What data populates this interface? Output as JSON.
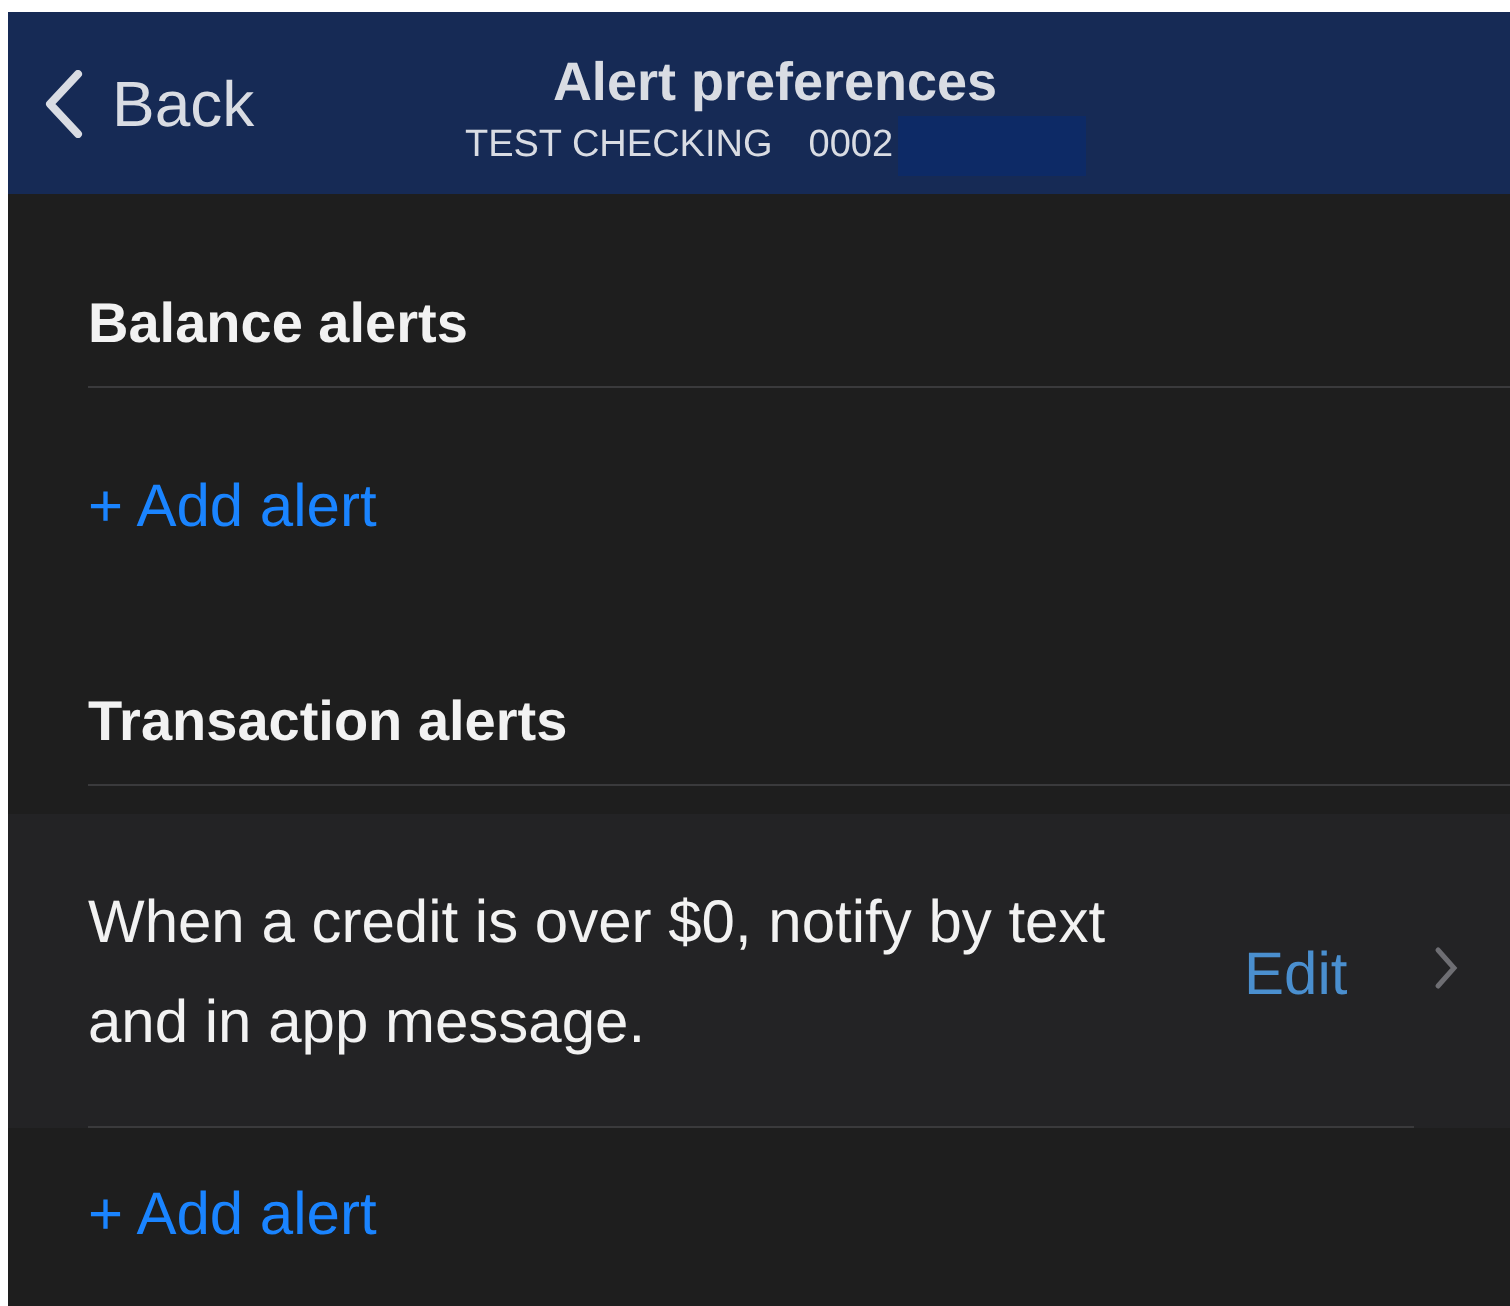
{
  "header": {
    "back": "Back",
    "title": "Alert preferences",
    "account_name": "TEST CHECKING",
    "account_number": "0002"
  },
  "sections": [
    {
      "title": "Balance alerts",
      "add_label": "+ Add alert"
    },
    {
      "title": "Transaction alerts",
      "alerts": [
        {
          "text": "When a credit is over $0, notify by text and in app message.",
          "action": "Edit"
        }
      ],
      "add_label": "+ Add alert"
    }
  ]
}
